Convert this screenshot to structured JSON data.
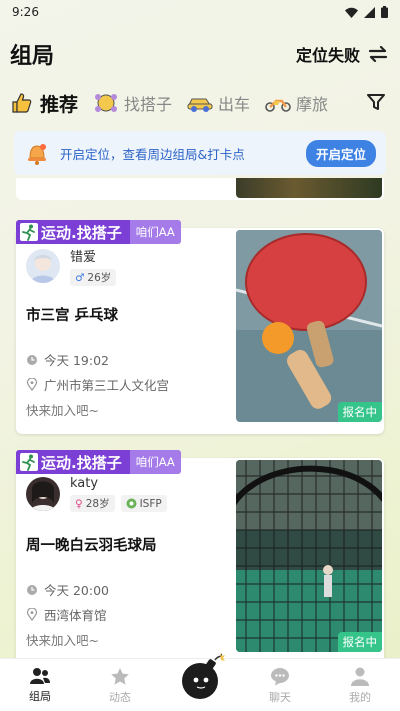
{
  "status_bar": {
    "time": "9:26"
  },
  "header": {
    "title": "组局",
    "location_status": "定位失败"
  },
  "tabs": [
    {
      "label": "推荐",
      "active": true,
      "icon": "thumbs-up-icon"
    },
    {
      "label": "找搭子",
      "active": false,
      "icon": "group-icon"
    },
    {
      "label": "出车",
      "active": false,
      "icon": "car-icon"
    },
    {
      "label": "摩旅",
      "active": false,
      "icon": "motorbike-icon"
    }
  ],
  "banner": {
    "text": "开启定位，查看周边组局&打卡点",
    "button": "开启定位"
  },
  "cards": [
    {
      "tag": "运动.找搭子",
      "tag_sub": "咱们AA",
      "username": "错爱",
      "gender_symbol": "♂",
      "age": "26岁",
      "personality": "",
      "title": "市三宫 乒乓球",
      "time": "今天 19:02",
      "place": "广州市第三工人文化宫",
      "join": "快来加入吧~",
      "status": "报名中"
    },
    {
      "tag": "运动.找搭子",
      "tag_sub": "咱们AA",
      "username": "katy",
      "gender_symbol": "♀",
      "age": "28岁",
      "personality": "ISFP",
      "title": "周一晚白云羽毛球局",
      "time": "今天 20:00",
      "place": "西湾体育馆",
      "join": "快来加入吧~",
      "status": "报名中"
    }
  ],
  "bottom_nav": [
    {
      "label": "组局",
      "active": true,
      "icon": "people-icon"
    },
    {
      "label": "动态",
      "active": false,
      "icon": "star-icon"
    },
    {
      "label": "",
      "active": false,
      "icon": "bomb-icon"
    },
    {
      "label": "聊天",
      "active": false,
      "icon": "chat-icon"
    },
    {
      "label": "我的",
      "active": false,
      "icon": "user-icon"
    }
  ],
  "colors": {
    "accent_blue": "#3e82e4",
    "tag_purple": "#7b3fd6",
    "status_green": "#35c58a"
  }
}
